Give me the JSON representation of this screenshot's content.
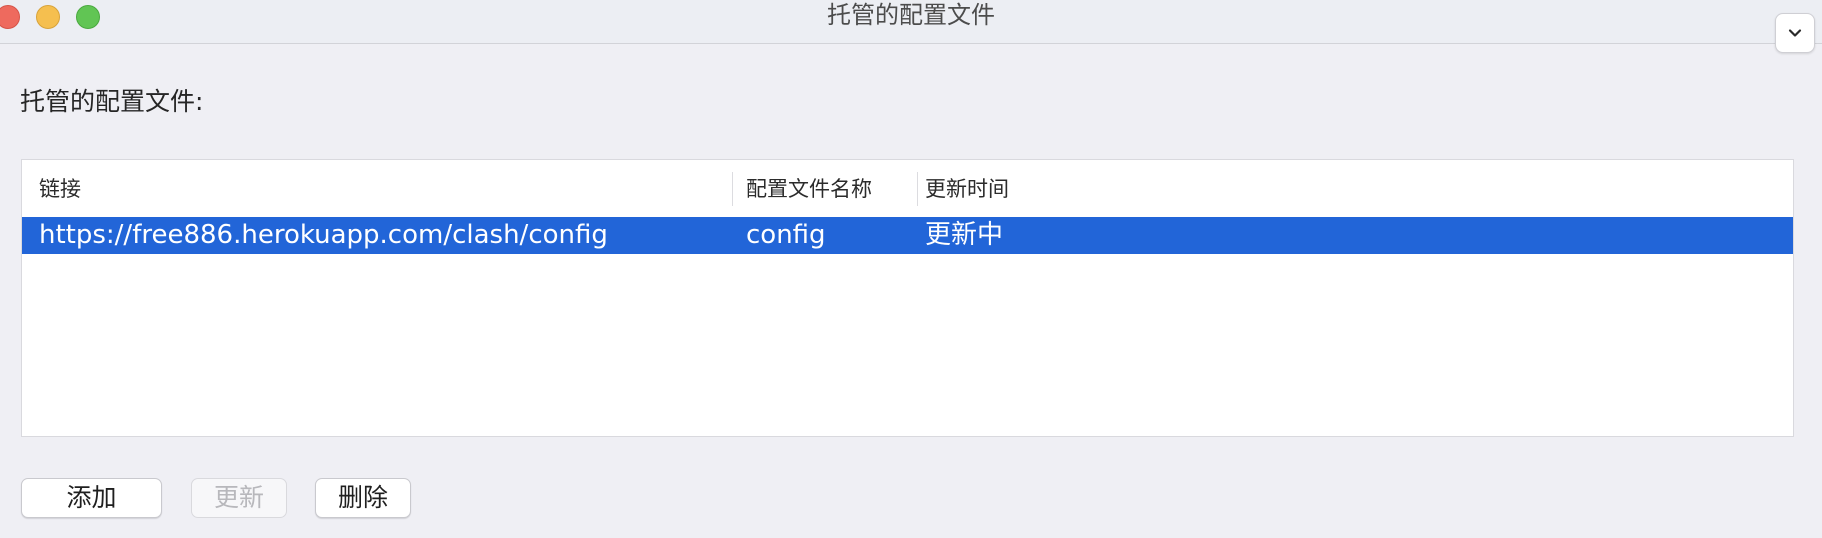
{
  "window": {
    "title": "托管的配置文件"
  },
  "section_label": "托管的配置文件:",
  "table": {
    "columns": [
      "链接",
      "配置文件名称",
      "更新时间"
    ],
    "rows": [
      [
        "https://free886.herokuapp.com/clash/config",
        "config",
        "更新中"
      ]
    ],
    "selected_row": 0
  },
  "buttons": {
    "add": "添加",
    "update": "更新",
    "delete": "删除"
  },
  "colors": {
    "selection": "#2265d8",
    "close": "#ee6a5e",
    "minimize": "#f5bf4f",
    "maximize": "#61c554"
  },
  "icons": {
    "collapse": "chevron-down-icon"
  }
}
